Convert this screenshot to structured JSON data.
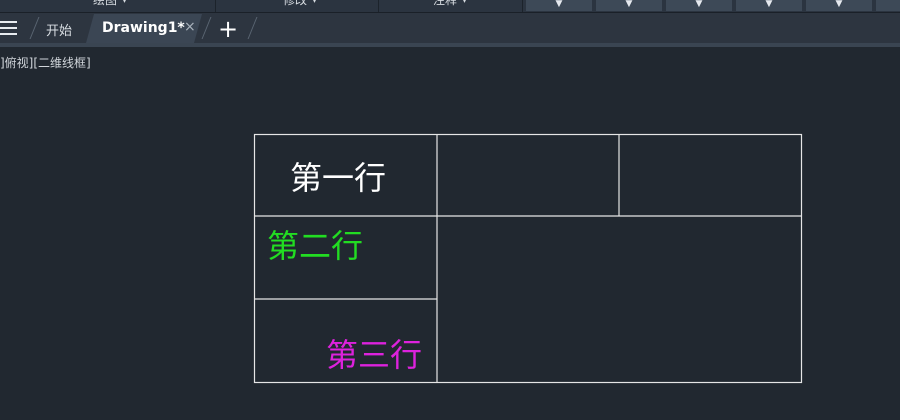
{
  "ribbon": {
    "panels": [
      "绘图",
      "修改",
      "注释"
    ],
    "caret": "▾",
    "dropdown_glyph": "▼"
  },
  "tabs": {
    "start_label": "开始",
    "active_label": "Drawing1*",
    "close_symbol": "×",
    "add_symbol": "+"
  },
  "viewport": {
    "label": "]俯视][二维线框]"
  },
  "table": {
    "row1": "第一行",
    "row2": "第二行",
    "row3": "第三行",
    "colors": {
      "row1": "#ffffff",
      "row2": "#22dd22",
      "row3": "#dd22dd",
      "lines": "#e6e6e6"
    }
  }
}
